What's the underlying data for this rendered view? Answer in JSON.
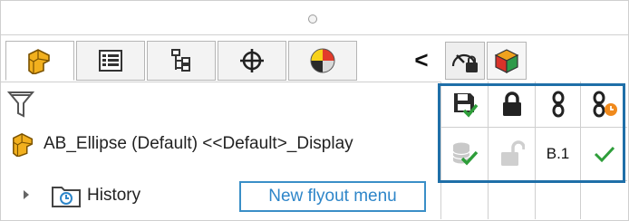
{
  "panel": {
    "tabs": [
      {
        "name": "FeatureManager"
      },
      {
        "name": "PropertyManager"
      },
      {
        "name": "ConfigurationManager"
      },
      {
        "name": "DimXpertManager"
      },
      {
        "name": "DisplayManager"
      }
    ],
    "collapse_glyph": "<"
  },
  "tree": {
    "part_label": "AB_Ellipse (Default) <<Default>_Display",
    "history_label": "History"
  },
  "grid": {
    "revision_value": "B.1"
  },
  "callout": {
    "label": "New flyout menu"
  },
  "colors": {
    "highlight_border": "#1f6fa8",
    "callout_text": "#2e86c9",
    "check_green": "#2e9e3a",
    "part_yellow": "#f2b01e",
    "pdm_orange": "#f08a1d"
  }
}
